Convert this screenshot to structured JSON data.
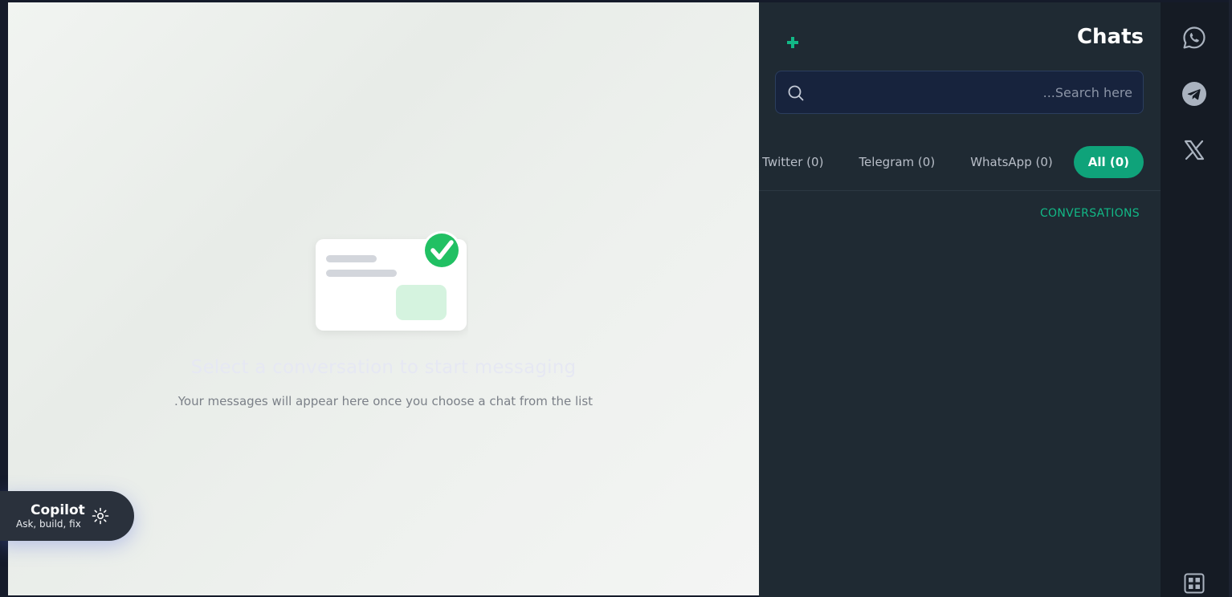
{
  "main": {
    "empty_title": "Select a conversation to start messaging",
    "empty_subtitle": ".Your messages will appear here once you choose a chat from the list",
    "illustration_icon": "chat-selected-illustration"
  },
  "copilot": {
    "title": "Copilot",
    "subtitle": "Ask, build, fix",
    "icon": "sparkle-icon"
  },
  "chats": {
    "title": "Chats",
    "add_icon": "plus-icon",
    "search": {
      "placeholder": "...Search here",
      "value": ""
    },
    "tabs": [
      {
        "label": "Twitter (0)",
        "active": false
      },
      {
        "label": "Telegram (0)",
        "active": false
      },
      {
        "label": "WhatsApp (0)",
        "active": false
      },
      {
        "label": "All (0)",
        "active": true
      }
    ],
    "section_label": "CONVERSATIONS"
  },
  "rail": {
    "items": [
      {
        "icon": "whatsapp-icon"
      },
      {
        "icon": "telegram-icon"
      },
      {
        "icon": "x-twitter-icon"
      },
      {
        "icon": "grid-icon"
      }
    ]
  },
  "colors": {
    "accent": "#12b886",
    "active_tab": "#0fa37a",
    "panel_bg": "#1f2a33",
    "search_bg": "#17233d"
  }
}
